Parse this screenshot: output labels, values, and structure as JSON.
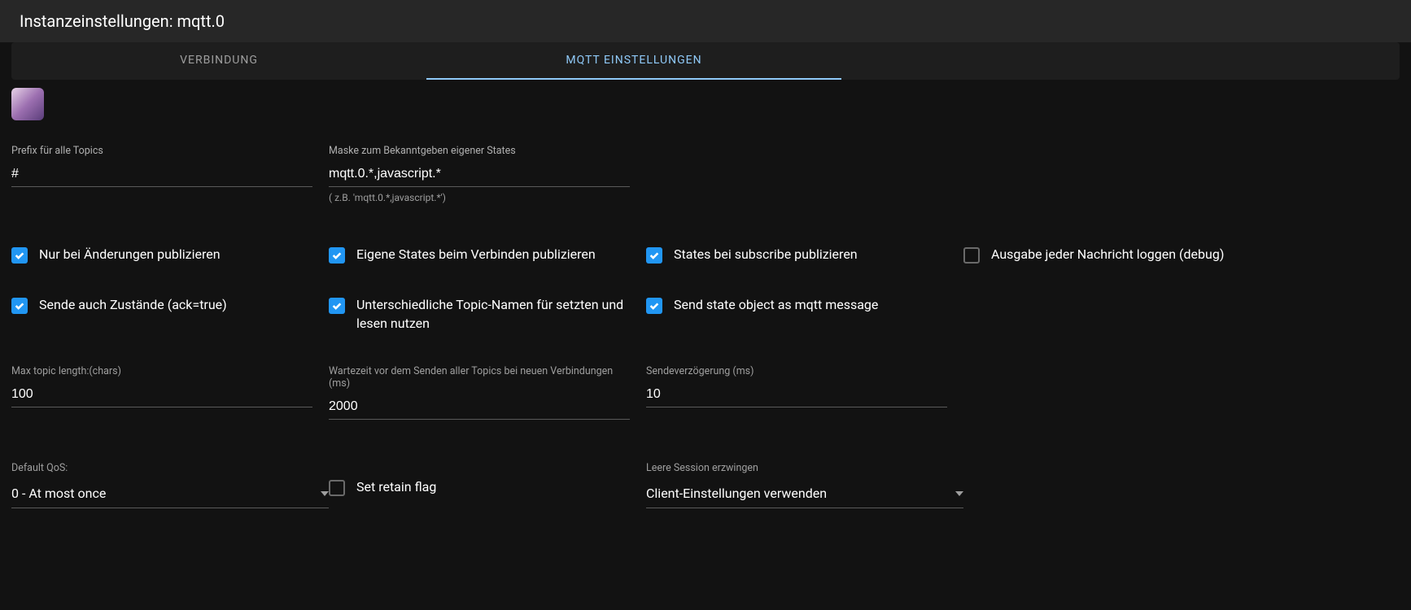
{
  "header": {
    "title": "Instanzeinstellungen: mqtt.0"
  },
  "tabs": {
    "connection": "VERBINDUNG",
    "mqtt_settings": "MQTT EINSTELLUNGEN"
  },
  "fields": {
    "prefix": {
      "label": "Prefix für alle Topics",
      "value": "#"
    },
    "mask": {
      "label": "Maske zum Bekanntgeben eigener States",
      "value": "mqtt.0.*,javascript.*",
      "helper": "( z.B. 'mqtt.0.*,javascript.*')"
    },
    "max_topic": {
      "label": "Max topic length:(chars)",
      "value": "100"
    },
    "wait": {
      "label": "Wartezeit vor dem Senden aller Topics bei neuen Verbindungen (ms)",
      "value": "2000"
    },
    "delay": {
      "label": "Sendeverzögerung (ms)",
      "value": "10"
    },
    "qos": {
      "label": "Default QoS:",
      "value": "0 - At most once"
    },
    "session": {
      "label": "Leere Session erzwingen",
      "value": "Client-Einstellungen verwenden"
    }
  },
  "checkboxes": {
    "only_changes": "Nur bei Änderungen publizieren",
    "own_states": "Eigene States beim Verbinden publizieren",
    "on_subscribe": "States bei subscribe publizieren",
    "log_debug": "Ausgabe jeder Nachricht loggen (debug)",
    "send_ack": "Sende auch Zustände (ack=true)",
    "diff_topics": "Unterschiedliche Topic-Namen für setzten und lesen nutzen",
    "send_object": "Send state object as mqtt message",
    "retain": "Set retain flag"
  }
}
